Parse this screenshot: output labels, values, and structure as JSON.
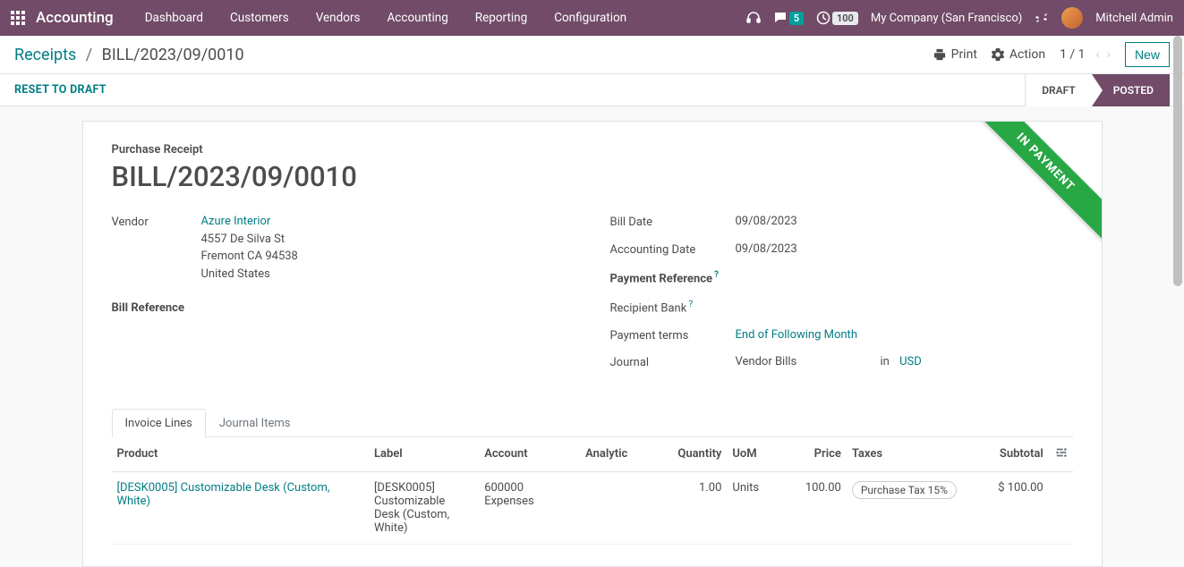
{
  "nav": {
    "brand": "Accounting",
    "items": [
      "Dashboard",
      "Customers",
      "Vendors",
      "Accounting",
      "Reporting",
      "Configuration"
    ],
    "msg_badge": "5",
    "clock_badge": "100",
    "company": "My Company (San Francisco)",
    "user": "Mitchell Admin"
  },
  "breadcrumb": {
    "parent": "Receipts",
    "current": "BILL/2023/09/0010"
  },
  "cp": {
    "print": "Print",
    "action": "Action",
    "pager": "1 / 1",
    "new": "New"
  },
  "statusbar": {
    "reset": "RESET TO DRAFT",
    "draft": "DRAFT",
    "posted": "POSTED"
  },
  "ribbon": "IN PAYMENT",
  "form": {
    "title_label": "Purchase Receipt",
    "title": "BILL/2023/09/0010",
    "labels": {
      "vendor": "Vendor",
      "bill_reference": "Bill Reference",
      "bill_date": "Bill Date",
      "accounting_date": "Accounting Date",
      "payment_reference": "Payment Reference",
      "recipient_bank": "Recipient Bank",
      "payment_terms": "Payment terms",
      "journal": "Journal",
      "in": "in"
    },
    "vendor": "Azure Interior",
    "address": {
      "street": "4557 De Silva St",
      "city": "Fremont CA 94538",
      "country": "United States"
    },
    "bill_date": "09/08/2023",
    "accounting_date": "09/08/2023",
    "payment_terms": "End of Following Month",
    "journal": "Vendor Bills",
    "currency": "USD"
  },
  "tabs": {
    "invoice_lines": "Invoice Lines",
    "journal_items": "Journal Items"
  },
  "table": {
    "headers": {
      "product": "Product",
      "label": "Label",
      "account": "Account",
      "analytic": "Analytic",
      "quantity": "Quantity",
      "uom": "UoM",
      "price": "Price",
      "taxes": "Taxes",
      "subtotal": "Subtotal"
    },
    "row": {
      "product": "[DESK0005] Customizable Desk (Custom, White)",
      "label": "[DESK0005] Customizable Desk (Custom, White)",
      "account": "600000 Expenses",
      "quantity": "1.00",
      "uom": "Units",
      "price": "100.00",
      "tax": "Purchase Tax 15%",
      "subtotal": "$ 100.00"
    }
  }
}
